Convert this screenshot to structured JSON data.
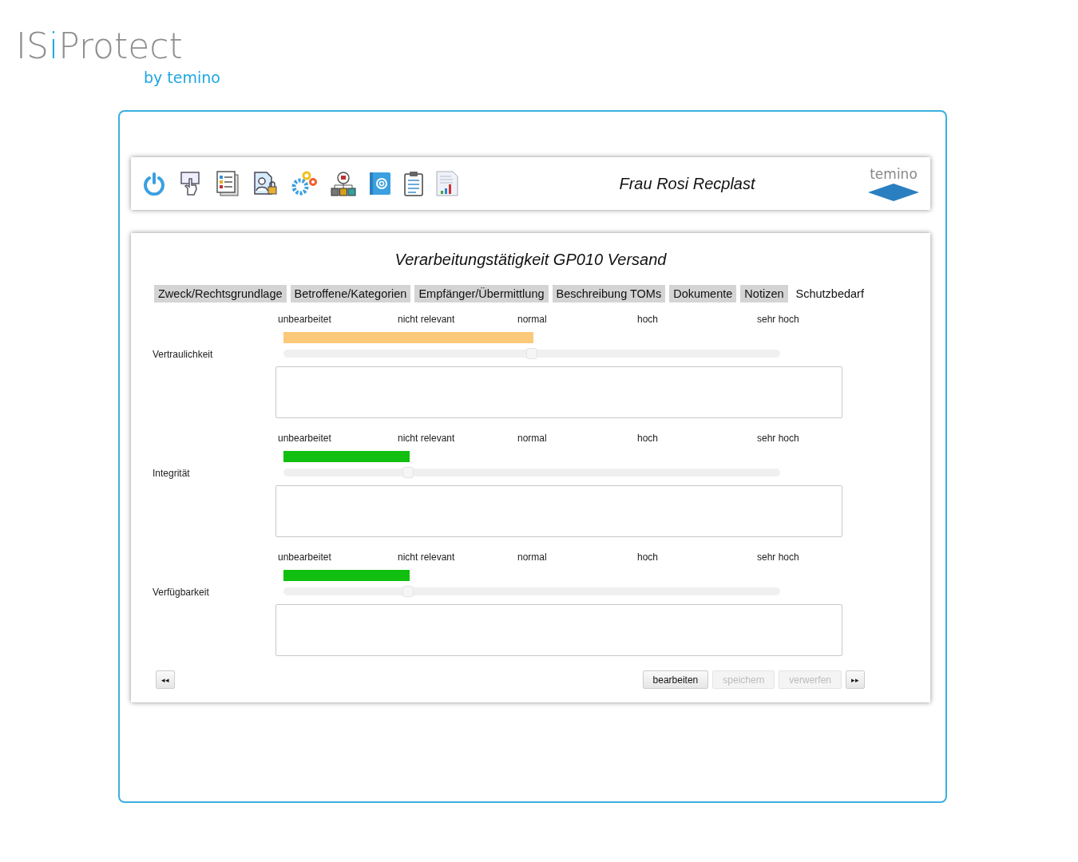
{
  "logo": {
    "parts": [
      {
        "text": "IS",
        "accent": false
      },
      {
        "text": "i",
        "accent": true
      },
      {
        "text": "Protect",
        "accent": false
      }
    ],
    "tagline": "by temino"
  },
  "header": {
    "toolbar": [
      {
        "kind": "power"
      },
      {
        "kind": "touch"
      },
      {
        "kind": "list"
      },
      {
        "kind": "lockdoc"
      },
      {
        "kind": "gears"
      },
      {
        "kind": "org"
      },
      {
        "kind": "address"
      },
      {
        "kind": "clipboard"
      },
      {
        "kind": "report"
      }
    ],
    "user": "Frau Rosi Recplast",
    "brand": "temino"
  },
  "title": "Verarbeitungstätigkeit GP010 Versand",
  "tabs": [
    {
      "label": "Zweck/Rechtsgrundlage",
      "selected": false
    },
    {
      "label": "Betroffene/Kategorien",
      "selected": false
    },
    {
      "label": "Empfänger/Übermittlung",
      "selected": false
    },
    {
      "label": "Beschreibung TOMs",
      "selected": false
    },
    {
      "label": "Dokumente",
      "selected": false
    },
    {
      "label": "Notizen",
      "selected": false
    },
    {
      "label": "Schutzbedarf",
      "selected": true
    }
  ],
  "criteria": [
    {
      "name": "Vertraulichkeit",
      "scale": [
        "unbearbeitet",
        "nicht relevant",
        "normal",
        "hoch",
        "sehr hoch"
      ],
      "level": 0.5,
      "color": "#fcc87a"
    },
    {
      "name": "Integrität",
      "scale": [
        "unbearbeitet",
        "nicht relevant",
        "normal",
        "hoch",
        "sehr hoch"
      ],
      "level": 0.25,
      "color": "#10bf10"
    },
    {
      "name": "Verfügbarkeit",
      "scale": [
        "unbearbeitet",
        "nicht relevant",
        "normal",
        "hoch",
        "sehr hoch"
      ],
      "level": 0.25,
      "color": "#10bf10"
    }
  ],
  "nav": {
    "prev": "◂◂",
    "next": "▸▸"
  },
  "actions": [
    {
      "label": "bearbeiten",
      "disabled": false
    },
    {
      "label": "speichern",
      "disabled": true
    },
    {
      "label": "verwerfen",
      "disabled": true
    }
  ]
}
